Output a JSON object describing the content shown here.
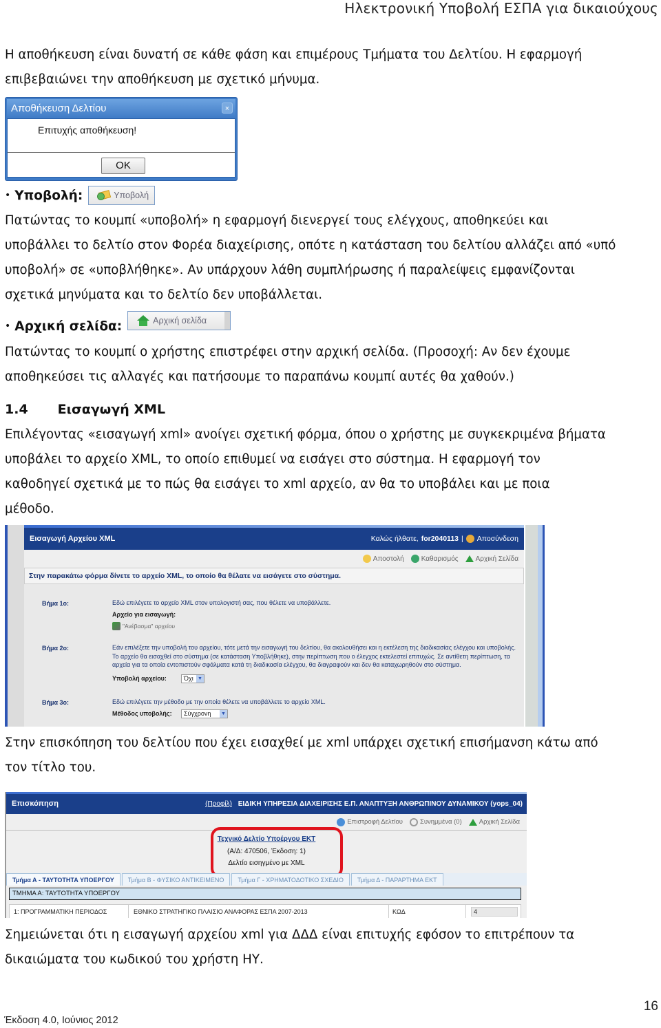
{
  "header": {
    "title": "Ηλεκτρονική Υποβολή ΕΣΠΑ για δικαιούχους"
  },
  "intro": {
    "line1": "Η αποθήκευση είναι δυνατή σε κάθε φάση και επιμέρους Τμήματα του Δελτίου. Η εφαρμογή",
    "line2": "επιβεβαιώνει την αποθήκευση με σχετικό μήνυμα."
  },
  "save_dialog": {
    "title": "Αποθήκευση Δελτίου",
    "close": "×",
    "message": "Επιτυχής αποθήκευση!",
    "ok_label": "OK"
  },
  "submit_section": {
    "bullet": "•",
    "heading": "Υποβολή:",
    "button_label": "Υποβολή",
    "lines": [
      "Πατώντας το κουμπί «υποβολή» η εφαρμογή διενεργεί τους ελέγχους, αποθηκεύει και",
      "υποβάλλει το δελτίο στον Φορέα διαχείρισης, οπότε η κατάσταση του δελτίου αλλάζει από «υπό",
      "υποβολή» σε «υποβλήθηκε». Αν υπάρχουν λάθη συμπλήρωσης ή παραλείψεις εμφανίζονται",
      "σχετικά μηνύματα και το δελτίο δεν υποβάλλεται."
    ]
  },
  "home_section": {
    "bullet": "•",
    "heading": "Αρχική σελίδα:",
    "button_label": "Αρχική σελίδα",
    "lines": [
      "Πατώντας το κουμπί ο χρήστης επιστρέφει στην αρχική σελίδα. (Προσοχή: Αν δεν έχουμε",
      "αποθηκεύσει τις αλλαγές και πατήσουμε το παραπάνω κουμπί αυτές θα χαθούν.)"
    ]
  },
  "section_14": {
    "number": "1.4",
    "title": "Εισαγωγή XML",
    "lines": [
      "Επιλέγοντας «εισαγωγή xml» ανοίγει σχετική φόρμα, όπου ο χρήστης με συγκεκριμένα βήματα",
      "υποβάλει το αρχείο XML, το οποίο επιθυμεί να εισάγει στο σύστημα. Η εφαρμογή τον",
      "καθοδηγεί σχετικά με το πώς θα εισάγει το xml αρχείο, αν θα το υποβάλει και με ποια",
      "μέθοδο."
    ]
  },
  "xml_screen": {
    "title": "Εισαγωγή Αρχείου XML",
    "welcome": "Καλώς ήλθατε,",
    "username": "for2040113",
    "separator": "|",
    "logout": "Αποσύνδεση",
    "toolbar": [
      {
        "icon": "send-icon",
        "label": "Αποστολή",
        "color": "#f2c94c"
      },
      {
        "icon": "clear-icon",
        "label": "Καθαρισμός",
        "color": "#3aa56a"
      },
      {
        "icon": "home-icon",
        "label": "Αρχική Σελίδα",
        "color": "#2e9e3e"
      }
    ],
    "intro": "Στην παρακάτω φόρμα δίνετε το αρχείο XML, το οποίο θα θέλατε να εισάγετε στο σύστημα.",
    "steps": [
      {
        "label": "Βήμα 1ο:",
        "text": "Εδώ επιλέγετε το αρχείο XML στον υπολογιστή σας, που θέλετε να υποβάλλετε.",
        "field_label": "Αρχείο για εισαγωγή:",
        "upload_label": "\"Ανέβασμα\" αρχείου"
      },
      {
        "label": "Βήμα 2ο:",
        "text": "Εάν επιλέξετε την υποβολή του αρχείου, τότε μετά την εισαγωγή του δελτίου, θα ακολουθήσει και η εκτέλεση της διαδικασίας ελέγχου και υποβολής. Το αρχείο θα εισαχθεί στο σύστημα (σε κατάσταση Υποβλήθηκε), στην περίπτωση που ο έλεγχος εκτελεστεί επιτυχώς. Σε αντίθετη περίπτωση, τα αρχεία για τα οποία εντοπιστούν σφάλματα κατά τη διαδικασία ελέγχου, θα διαγραφούν και δεν θα καταχωρηθούν στο σύστημα.",
        "field_label": "Υποβολή αρχείου:",
        "select_value": "Όχι"
      },
      {
        "label": "Βήμα 3ο:",
        "text": "Εδώ επιλέγετε την μέθοδο με την οποία θέλετε να υποβάλλετε το αρχείο XML.",
        "field_label": "Μέθοδος υποβολής:",
        "select_value": "Σύγχρονη"
      }
    ],
    "dropdown_arrow": "▼"
  },
  "after_xml": {
    "lines": [
      "Στην επισκόπηση του δελτίου που έχει εισαχθεί με xml υπάρχει σχετική επισήμανση κάτω από",
      "τον τίτλο του."
    ]
  },
  "overview_screen": {
    "title": "Επισκόπηση",
    "profile_link": "(Προφίλ)",
    "agency": "ΕΙΔΙΚΗ ΥΠΗΡΕΣΙΑ ΔΙΑΧΕΙΡΙΣΗΣ Ε.Π. ΑΝΑΠΤΥΞΗ ΑΝΘΡΩΠΙΝΟΥ ΔΥΝΑΜΙΚΟΥ (yops_04)",
    "toolbar": [
      {
        "icon": "return-icon",
        "label": "Επιστροφή Δελτίου",
        "color": "#4a8fd8"
      },
      {
        "icon": "paperclip-icon",
        "label": "Συνημμένα (0)",
        "color": "#999999"
      },
      {
        "icon": "home-icon",
        "label": "Αρχική Σελίδα",
        "color": "#2e9e3e"
      }
    ],
    "doc_title": "Τεχνικό Δελτίο Υποέργου ΕΚΤ",
    "doc_meta": "(Α/Δ: 470506, Έκδοση: 1)",
    "doc_note": "Δελτίο εισηγμένο με XML",
    "highlight_color": "#e0141e",
    "tabs": [
      {
        "label": "Τμήμα Α - ΤΑΥΤΟΤΗΤΑ ΥΠΟΕΡΓΟΥ",
        "active": true
      },
      {
        "label": "Τμήμα Β - ΦΥΣΙΚΟ ΑΝΤΙΚΕΙΜΕΝΟ",
        "active": false
      },
      {
        "label": "Τμήμα Γ - ΧΡΗΜΑΤΟΔΟΤΙΚΟ ΣΧΕΔΙΟ",
        "active": false
      },
      {
        "label": "Τμήμα Δ - ΠΑΡΑΡΤΗΜΑ ΕΚΤ",
        "active": false
      }
    ],
    "section_header": "ΤΜΗΜΑ Α: ΤΑΥΤΟΤΗΤΑ ΥΠΟΕΡΓΟΥ",
    "row": {
      "label": "1: ΠΡΟΓΡΑΜΜΑΤΙΚΗ ΠΕΡΙΟΔΟΣ",
      "value": "ΕΘΝΙΚΟ ΣΤΡΑΤΗΓΙΚΟ ΠΛΑΙΣΙΟ ΑΝΑΦΟΡΑΣ ΕΣΠΑ 2007-2013",
      "code_label": "ΚΩΔ",
      "code_value": "4"
    }
  },
  "closing": {
    "lines": [
      "Σημειώνεται ότι η εισαγωγή αρχείου xml για ΔΔΔ είναι επιτυχής εφόσον το επιτρέπουν τα",
      "δικαιώματα του κωδικού του χρήστη ΗΥ."
    ]
  },
  "footer": {
    "edition": "Έκδοση 4.0, Ιούνιος 2012",
    "page_number": "16"
  }
}
